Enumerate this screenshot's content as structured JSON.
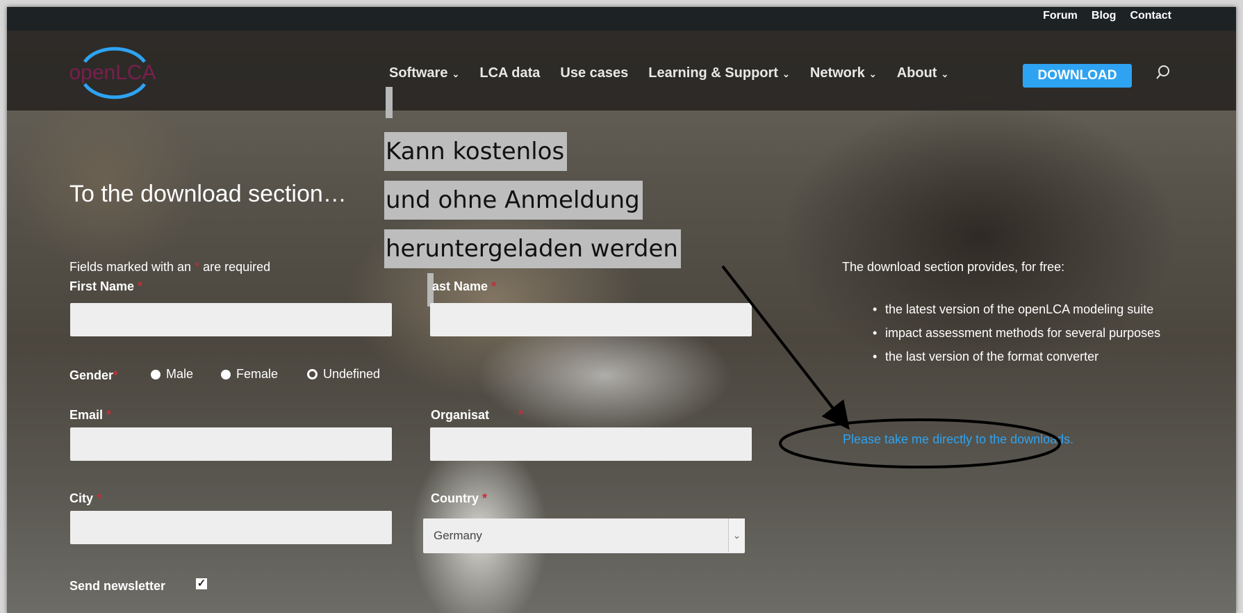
{
  "top_links": [
    "Forum",
    "Blog",
    "Contact"
  ],
  "brand": {
    "logo_text": "openLCA",
    "accent": "#2ea3f2",
    "logo_color": "#7a1e4f"
  },
  "nav": {
    "items": [
      {
        "label": "Software",
        "dropdown": true
      },
      {
        "label": "LCA data",
        "dropdown": false
      },
      {
        "label": "Use cases",
        "dropdown": false
      },
      {
        "label": "Learning & Support",
        "dropdown": true
      },
      {
        "label": "Network",
        "dropdown": true
      },
      {
        "label": "About",
        "dropdown": true
      }
    ],
    "download_label": "DOWNLOAD",
    "search_icon": "search-icon"
  },
  "annotation": {
    "lines": [
      "Kann kostenlos",
      "und ohne Anmeldung",
      "heruntergeladen werden"
    ]
  },
  "form": {
    "title": "To the download section…",
    "required_note_before": "Fields marked with an ",
    "required_note_star": "*",
    "required_note_after": " are required",
    "first_name_label": "First Name",
    "last_name_label": "ast Name",
    "gender_label": "Gender",
    "gender_options": [
      "Male",
      "Female",
      "Undefined"
    ],
    "email_label": "Email",
    "organisation_label": "Organisat",
    "city_label": "City",
    "country_label": "Country",
    "country_value": "Germany",
    "newsletter_label": "Send newsletter",
    "newsletter_checked": true,
    "required_star": "*"
  },
  "side": {
    "intro": "The download section provides, for free:",
    "items": [
      "the latest version of the openLCA modeling suite",
      "impact assessment methods for several purposes",
      "the last version of the format converter"
    ],
    "direct_link": "Please take me directly to the downloads."
  }
}
